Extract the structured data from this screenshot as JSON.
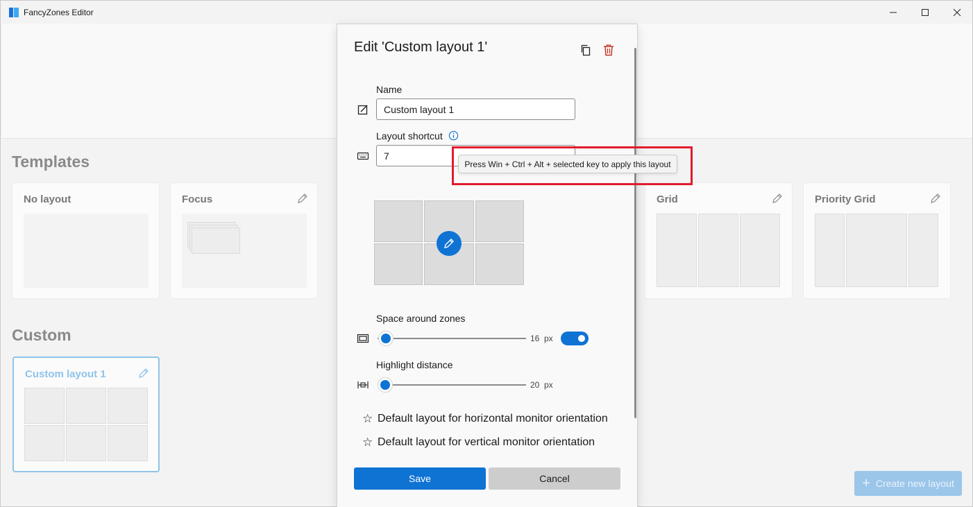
{
  "window": {
    "title": "FancyZones Editor",
    "controls": {
      "minimize": "—",
      "maximize": "☐",
      "close": "✕"
    }
  },
  "sections": {
    "templates": "Templates",
    "custom": "Custom"
  },
  "templates": [
    {
      "label": "No layout",
      "editable": false
    },
    {
      "label": "Focus",
      "editable": true
    },
    {
      "label": "Grid",
      "editable": true
    },
    {
      "label": "Priority Grid",
      "editable": true
    }
  ],
  "custom_layouts": [
    {
      "label": "Custom layout 1",
      "editable": true
    }
  ],
  "dialog": {
    "title": "Edit 'Custom layout 1'",
    "name_label": "Name",
    "name_value": "Custom layout 1",
    "shortcut_label": "Layout shortcut",
    "shortcut_value": "7",
    "tooltip": "Press Win + Ctrl + Alt + selected key to apply this layout",
    "space_label": "Space around zones",
    "space_value": "16",
    "space_unit": "px",
    "space_enabled": true,
    "highlight_label": "Highlight distance",
    "highlight_value": "20",
    "highlight_unit": "px",
    "default_horizontal": "Default layout for horizontal monitor orientation",
    "default_vertical": "Default layout for vertical monitor orientation",
    "save_label": "Save",
    "cancel_label": "Cancel",
    "icons": {
      "duplicate": "copy-icon",
      "delete": "trash-icon",
      "name": "rename-icon",
      "shortcut": "keyboard-icon",
      "space": "space-icon",
      "highlight": "distance-icon",
      "info": "info-icon",
      "star": "☆"
    }
  },
  "create_button": {
    "label": "Create new layout",
    "icon": "+"
  },
  "colors": {
    "accent": "#0f73d4",
    "highlight_border": "#e21b2c",
    "delete_icon": "#c42b1c"
  }
}
